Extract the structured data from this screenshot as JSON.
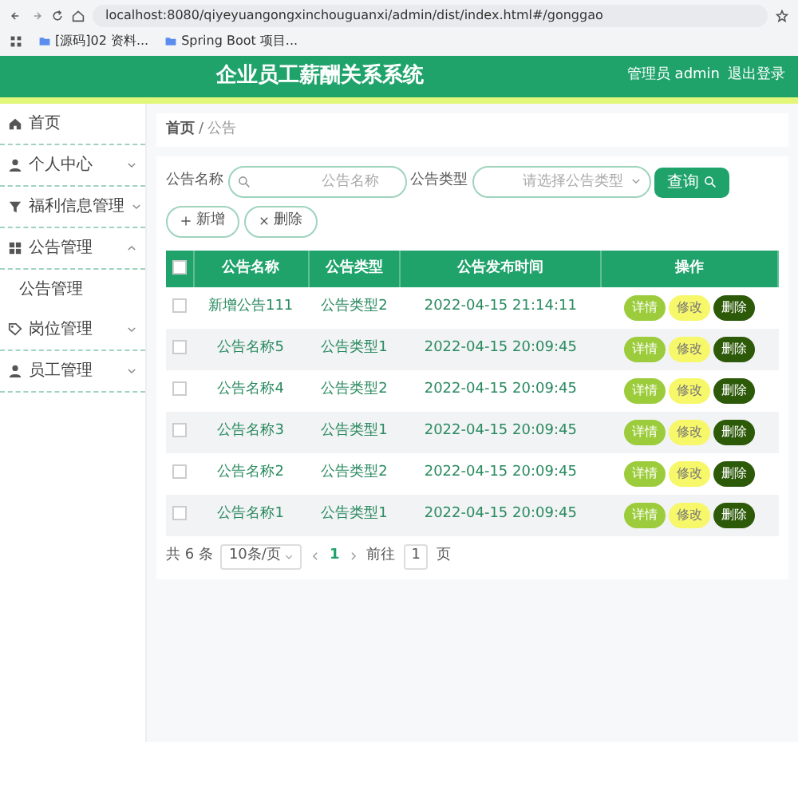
{
  "browser": {
    "address": "localhost:8080/qiyeyuangongxinchouguanxi/admin/dist/index.html#/gonggao",
    "bookmarks": [
      "[源码]02 资料...",
      "Spring Boot 项目..."
    ]
  },
  "header": {
    "title": "企业员工薪酬关系系统",
    "user": "管理员 admin",
    "logout": "退出登录"
  },
  "sidebar": {
    "items": [
      {
        "kind": "home",
        "label": "首页"
      },
      {
        "kind": "user",
        "label": "个人中心",
        "expanded": false
      },
      {
        "kind": "filter",
        "label": "福利信息管理",
        "expanded": false
      },
      {
        "kind": "grid",
        "label": "公告管理",
        "expanded": true,
        "children": [
          {
            "label": "公告管理"
          }
        ]
      },
      {
        "kind": "tag",
        "label": "岗位管理",
        "expanded": false
      },
      {
        "kind": "user",
        "label": "员工管理",
        "expanded": false
      }
    ]
  },
  "breadcrumb": {
    "items": [
      "首页",
      "公告"
    ],
    "separator": "/"
  },
  "search": {
    "fields": [
      {
        "kind": "text",
        "label": "公告名称",
        "placeholder": "公告名称"
      },
      {
        "kind": "select",
        "label": "公告类型",
        "placeholder": "请选择公告类型"
      }
    ],
    "button": "查询"
  },
  "actions": [
    {
      "kind": "add",
      "label": "新增"
    },
    {
      "kind": "delete",
      "label": "删除"
    }
  ],
  "table": {
    "select_all_checked": false,
    "columns": [
      "公告名称",
      "公告类型",
      "公告发布时间",
      "操作"
    ],
    "rows": [
      {
        "checked": false,
        "cells": [
          "新增公告111",
          "公告类型2",
          "2022-04-15 21:14:11"
        ],
        "buttons": [
          {
            "kind": "detail",
            "label": "详情"
          },
          {
            "kind": "edit",
            "label": "修改"
          },
          {
            "kind": "delete",
            "label": "删除"
          }
        ]
      },
      {
        "checked": false,
        "cells": [
          "公告名称5",
          "公告类型1",
          "2022-04-15 20:09:45"
        ],
        "buttons": [
          {
            "kind": "detail",
            "label": "详情"
          },
          {
            "kind": "edit",
            "label": "修改"
          },
          {
            "kind": "delete",
            "label": "删除"
          }
        ]
      },
      {
        "checked": false,
        "cells": [
          "公告名称4",
          "公告类型2",
          "2022-04-15 20:09:45"
        ],
        "buttons": [
          {
            "kind": "detail",
            "label": "详情"
          },
          {
            "kind": "edit",
            "label": "修改"
          },
          {
            "kind": "delete",
            "label": "删除"
          }
        ]
      },
      {
        "checked": false,
        "cells": [
          "公告名称3",
          "公告类型1",
          "2022-04-15 20:09:45"
        ],
        "buttons": [
          {
            "kind": "detail",
            "label": "详情"
          },
          {
            "kind": "edit",
            "label": "修改"
          },
          {
            "kind": "delete",
            "label": "删除"
          }
        ]
      },
      {
        "checked": false,
        "cells": [
          "公告名称2",
          "公告类型2",
          "2022-04-15 20:09:45"
        ],
        "buttons": [
          {
            "kind": "detail",
            "label": "详情"
          },
          {
            "kind": "edit",
            "label": "修改"
          },
          {
            "kind": "delete",
            "label": "删除"
          }
        ]
      },
      {
        "checked": false,
        "cells": [
          "公告名称1",
          "公告类型1",
          "2022-04-15 20:09:45"
        ],
        "buttons": [
          {
            "kind": "detail",
            "label": "详情"
          },
          {
            "kind": "edit",
            "label": "修改"
          },
          {
            "kind": "delete",
            "label": "删除"
          }
        ]
      }
    ]
  },
  "pagination": {
    "total": "共 6 条",
    "page_size": "10条/页",
    "pages": [
      {
        "label": "1",
        "selected": true
      }
    ],
    "goto_label": "前往",
    "goto_value": "1",
    "page_suffix": "页"
  }
}
